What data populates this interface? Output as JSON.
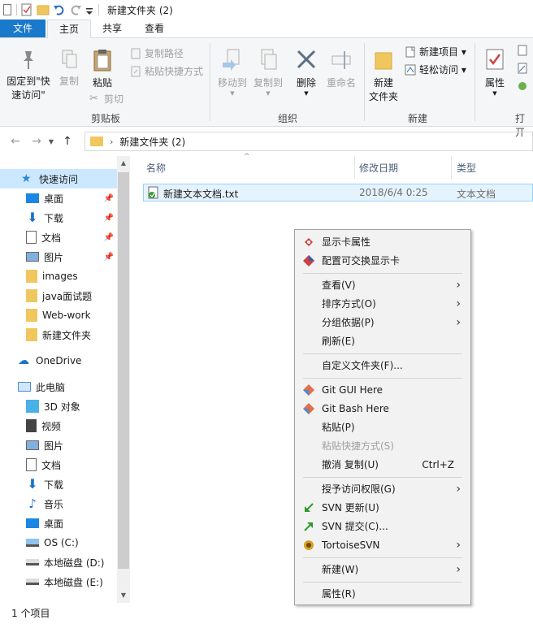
{
  "window": {
    "title": "新建文件夹 (2)"
  },
  "tabs": [
    "文件",
    "主页",
    "共享",
    "查看"
  ],
  "ribbon": {
    "pin_label": "固定到\"快\n速访问\"",
    "copy_label": "复制",
    "paste_label": "粘贴",
    "copy_path": "复制路径",
    "paste_shortcut": "粘贴快捷方式",
    "cut": "剪切",
    "clipboard_group": "剪贴板",
    "move_to": "移动到",
    "copy_to": "复制到",
    "delete": "删除",
    "rename": "重命名",
    "organize_group": "组织",
    "new_folder": "新建\n文件夹",
    "new_item": "新建项目 ▾",
    "easy_access": "轻松访问 ▾",
    "new_group": "新建",
    "properties": "属性",
    "open_group": "打开"
  },
  "address": {
    "path": "新建文件夹 (2)"
  },
  "nav": {
    "quick_access": "快速访问",
    "items_quick": [
      "桌面",
      "下载",
      "文档",
      "图片",
      "images",
      "java面试题",
      "Web-work",
      "新建文件夹"
    ],
    "onedrive": "OneDrive",
    "this_pc": "此电脑",
    "items_pc": [
      "3D 对象",
      "视频",
      "图片",
      "文档",
      "下载",
      "音乐",
      "桌面",
      "OS (C:)",
      "本地磁盘 (D:)",
      "本地磁盘 (E:)"
    ]
  },
  "columns": {
    "name": "名称",
    "modified": "修改日期",
    "type": "类型"
  },
  "files": [
    {
      "name": "新建文本文档.txt",
      "modified": "2018/6/4 0:25",
      "type": "文本文档"
    }
  ],
  "status": {
    "count": "1 个项目"
  },
  "context_menu": {
    "display_props": "显示卡属性",
    "switchable_gpu": "配置可交换显示卡",
    "view": "查看(V)",
    "sort_by": "排序方式(O)",
    "group_by": "分组依据(P)",
    "refresh": "刷新(E)",
    "customize": "自定义文件夹(F)...",
    "git_gui": "Git GUI Here",
    "git_bash": "Git Bash Here",
    "paste": "粘贴(P)",
    "paste_shortcut": "粘贴快捷方式(S)",
    "undo_copy": "撤消 复制(U)",
    "undo_shortcut": "Ctrl+Z",
    "grant_access": "授予访问权限(G)",
    "svn_update": "SVN 更新(U)",
    "svn_commit": "SVN 提交(C)...",
    "tortoise": "TortoiseSVN",
    "new": "新建(W)",
    "properties": "属性(R)"
  },
  "colors": {
    "accent": "#1979ca",
    "selection": "#cce8ff",
    "folder": "#f0c75e"
  }
}
